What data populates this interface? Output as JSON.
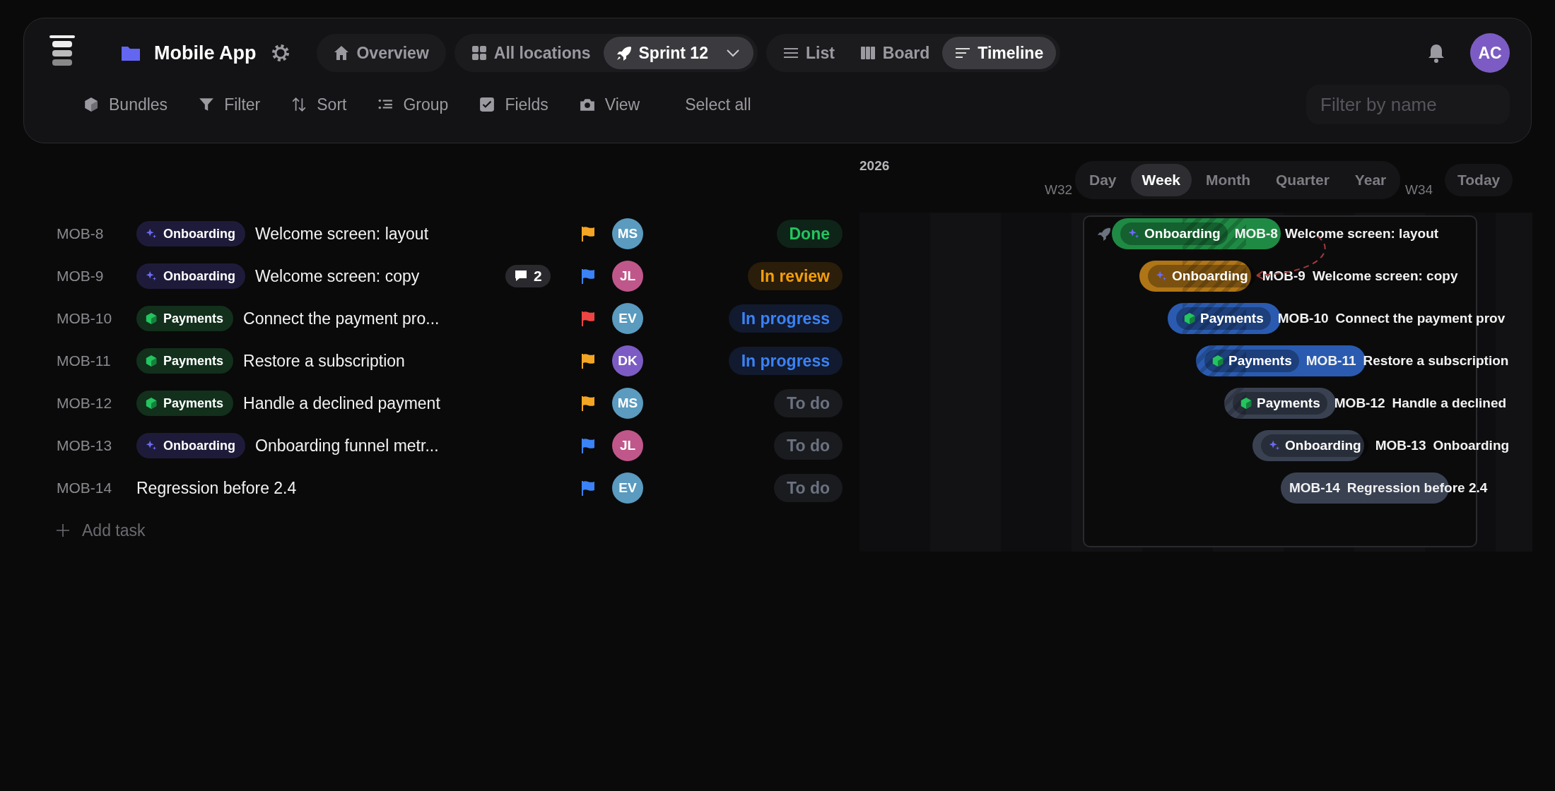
{
  "header": {
    "project": "Mobile App",
    "nav": [
      {
        "label": "Overview",
        "selected": false
      }
    ],
    "scope": [
      {
        "label": "All locations",
        "selected": false
      },
      {
        "label": "Sprint 12",
        "selected": true
      }
    ],
    "views": [
      {
        "label": "List",
        "selected": false
      },
      {
        "label": "Board",
        "selected": false
      },
      {
        "label": "Timeline",
        "selected": true
      }
    ],
    "avatar": {
      "initials": "AC",
      "color": "#7c5cc4"
    }
  },
  "toolbar": {
    "items": [
      "Bundles",
      "Filter",
      "Sort",
      "Group",
      "Fields",
      "View"
    ],
    "select_all": "Select all",
    "filter": {
      "placeholder": "Filter by name"
    }
  },
  "tasks": [
    {
      "id": "MOB-8",
      "tag": {
        "label": "Onboarding",
        "kind": "onboarding"
      },
      "title": "Welcome screen: layout",
      "flag": {
        "color": "#f5a524"
      },
      "assignee": {
        "initials": "MS",
        "color": "#5a9bbf"
      },
      "status": {
        "label": "Done",
        "kind": "done"
      }
    },
    {
      "id": "MOB-9",
      "tag": {
        "label": "Onboarding",
        "kind": "onboarding"
      },
      "title": "Welcome screen: copy",
      "comments": "2",
      "flag": {
        "color": "#3b82f6"
      },
      "assignee": {
        "initials": "JL",
        "color": "#c0578a"
      },
      "status": {
        "label": "In review",
        "kind": "review"
      }
    },
    {
      "id": "MOB-10",
      "tag": {
        "label": "Payments",
        "kind": "payments"
      },
      "title": "Connect the payment pro...",
      "flag": {
        "color": "#ef4444"
      },
      "assignee": {
        "initials": "EV",
        "color": "#5a9bbf"
      },
      "status": {
        "label": "In progress",
        "kind": "progress"
      }
    },
    {
      "id": "MOB-11",
      "tag": {
        "label": "Payments",
        "kind": "payments"
      },
      "title": "Restore a subscription",
      "flag": {
        "color": "#f5a524"
      },
      "assignee": {
        "initials": "DK",
        "color": "#7c5cc4"
      },
      "status": {
        "label": "In progress",
        "kind": "progress"
      }
    },
    {
      "id": "MOB-12",
      "tag": {
        "label": "Payments",
        "kind": "payments"
      },
      "title": "Handle a declined payment",
      "flag": {
        "color": "#f5a524"
      },
      "assignee": {
        "initials": "MS",
        "color": "#5a9bbf"
      },
      "status": {
        "label": "To do",
        "kind": "todo"
      }
    },
    {
      "id": "MOB-13",
      "tag": {
        "label": "Onboarding",
        "kind": "onboarding"
      },
      "title": "Onboarding funnel metr...",
      "flag": {
        "color": "#3b82f6"
      },
      "assignee": {
        "initials": "JL",
        "color": "#c0578a"
      },
      "status": {
        "label": "To do",
        "kind": "todo"
      }
    },
    {
      "id": "MOB-14",
      "title": "Regression before 2.4",
      "flag": {
        "color": "#3b82f6"
      },
      "assignee": {
        "initials": "EV",
        "color": "#5a9bbf"
      },
      "status": {
        "label": "To do",
        "kind": "todo"
      }
    }
  ],
  "add_task": "Add task",
  "timeline": {
    "year": "2026",
    "weeks": [
      "W32",
      "W34"
    ],
    "scales": [
      {
        "label": "Day",
        "selected": false
      },
      {
        "label": "Week",
        "selected": true
      },
      {
        "label": "Month",
        "selected": false
      },
      {
        "label": "Quarter",
        "selected": false
      },
      {
        "label": "Year",
        "selected": false
      }
    ],
    "today": "Today",
    "bars": [
      {
        "tag": {
          "label": "Onboarding",
          "kind": "onboarding"
        },
        "id": "MOB-8",
        "title": "Welcome screen: layout",
        "kind": "done"
      },
      {
        "tag": {
          "label": "Onboarding",
          "kind": "onboarding"
        },
        "id": "MOB-9",
        "title": "Welcome screen: copy",
        "kind": "review"
      },
      {
        "tag": {
          "label": "Payments",
          "kind": "payments"
        },
        "id": "MOB-10",
        "title": "Connect the payment prov",
        "kind": "progress"
      },
      {
        "tag": {
          "label": "Payments",
          "kind": "payments"
        },
        "id": "MOB-11",
        "title": "Restore a subscription",
        "kind": "progress"
      },
      {
        "tag": {
          "label": "Payments",
          "kind": "payments"
        },
        "id": "MOB-12",
        "title": "Handle a declined",
        "kind": "todo"
      },
      {
        "tag": {
          "label": "Onboarding",
          "kind": "onboarding"
        },
        "id": "MOB-13",
        "title": "Onboarding",
        "kind": "todo"
      },
      {
        "id": "MOB-14",
        "title": "Regression before 2.4",
        "kind": "todo"
      }
    ]
  }
}
